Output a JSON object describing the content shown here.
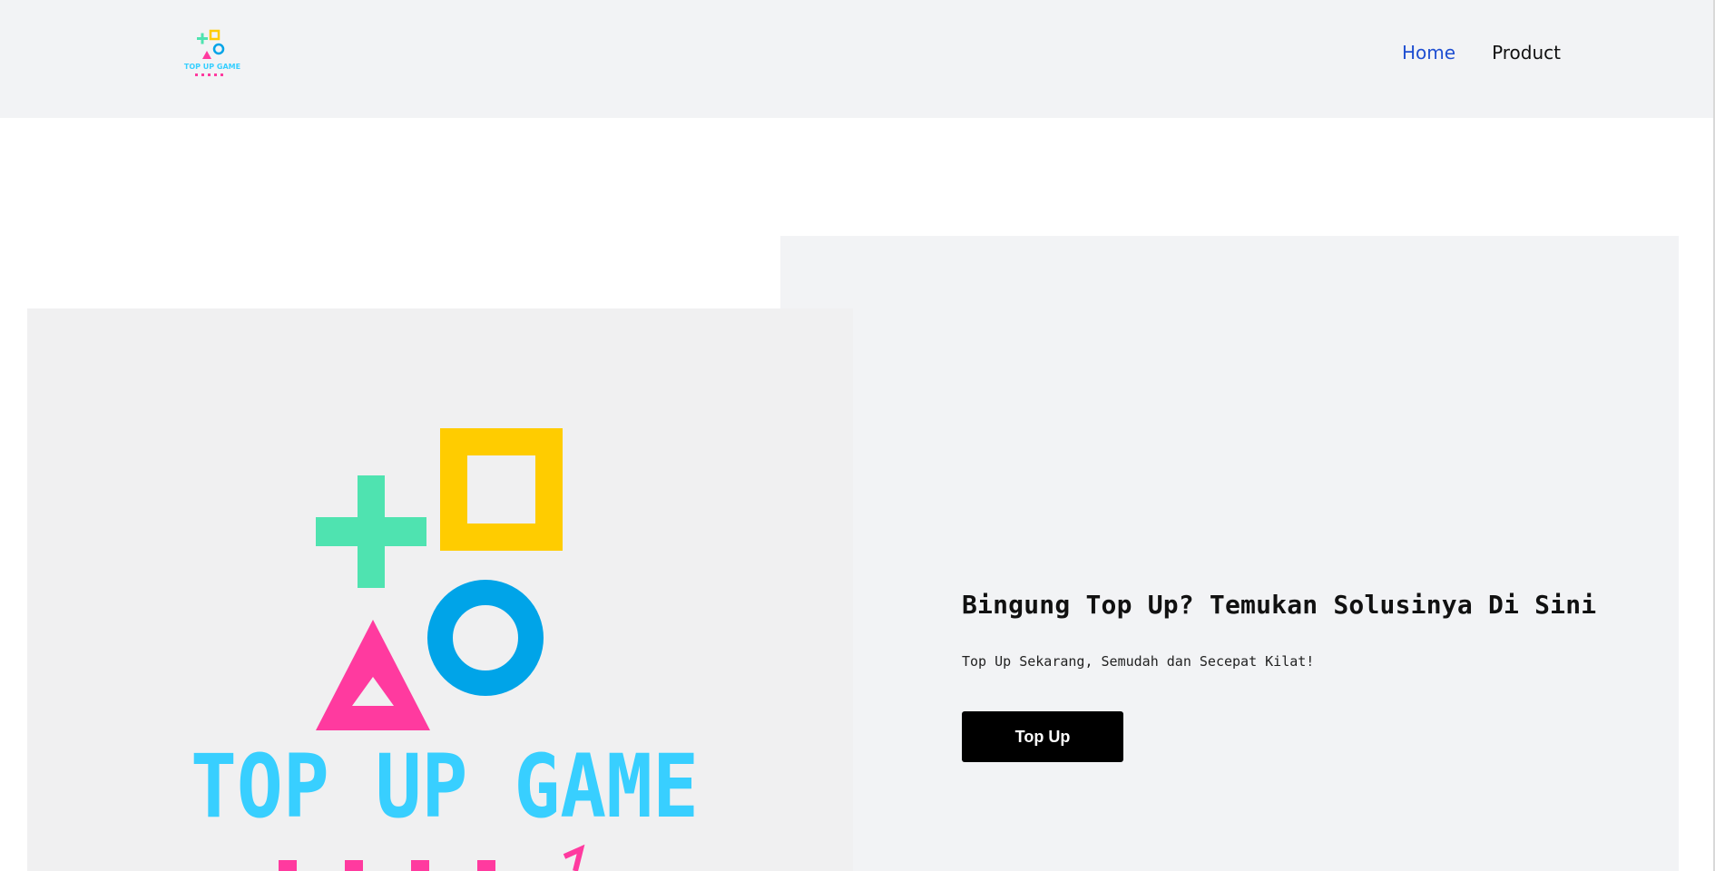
{
  "header": {
    "logo_icon": "top-up-game-logo",
    "nav": [
      {
        "label": "Home",
        "active": true
      },
      {
        "label": "Product",
        "active": false
      }
    ]
  },
  "hero": {
    "title": "Bingung Top Up? Temukan Solusinya Di Sini",
    "subtitle": "Top Up Sekarang, Semudah dan Secepat Kilat!",
    "button_label": "Top Up",
    "image_logo_text": "TOP UP GAME"
  },
  "colors": {
    "header_bg": "#f2f3f5",
    "nav_active": "#1f4fd1",
    "panel_bg": "#f2f3f5",
    "button_bg": "#000000",
    "green_plus": "#4fe3b0",
    "yellow_square": "#ffcc00",
    "blue_circle": "#00a4e8",
    "pink_triangle": "#ff3a9f",
    "logo_text_blue": "#38cfff"
  }
}
